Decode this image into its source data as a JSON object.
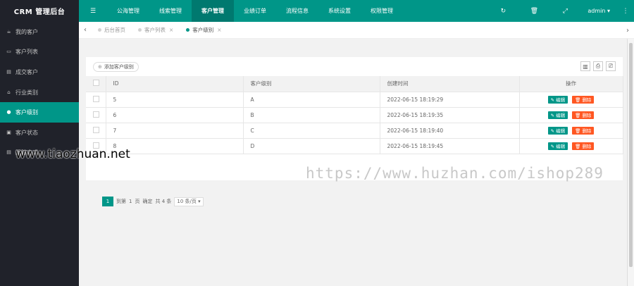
{
  "app": {
    "logo": "CRM  管理后台"
  },
  "sidebar": {
    "items": [
      {
        "icon": "☕",
        "label": "我的客户",
        "active": false
      },
      {
        "icon": "▭",
        "label": "客户列表",
        "active": false
      },
      {
        "icon": "▤",
        "label": "成交客户",
        "active": false
      },
      {
        "icon": "⌂",
        "label": "行业类别",
        "active": false
      },
      {
        "icon": "●",
        "label": "客户级别",
        "active": true
      },
      {
        "icon": "▣",
        "label": "客户状态",
        "active": false
      },
      {
        "icon": "▤",
        "label": "跟踪方式",
        "active": false
      }
    ]
  },
  "topnav": {
    "menu_icon": "☰",
    "items": [
      {
        "label": "公海管理",
        "active": false
      },
      {
        "label": "线索管理",
        "active": false
      },
      {
        "label": "客户管理",
        "active": true
      },
      {
        "label": "业绩订单",
        "active": false
      },
      {
        "label": "流程信息",
        "active": false
      },
      {
        "label": "系统设置",
        "active": false
      },
      {
        "label": "权限管理",
        "active": false
      }
    ],
    "refresh_icon": "↻",
    "clear_icon": "🗑",
    "fullscreen_icon": "⤢",
    "user": "admin ▾",
    "more_icon": "⋮"
  },
  "tabs": {
    "left_arrow": "‹",
    "right_arrow": "›",
    "items": [
      {
        "label": "后台首页",
        "closable": false,
        "active": false
      },
      {
        "label": "客户列表",
        "closable": true,
        "active": false
      },
      {
        "label": "客户级别",
        "closable": true,
        "active": true
      }
    ],
    "close_glyph": "×"
  },
  "toolbar": {
    "add_label": "添加客户级别",
    "add_icon": "⊕",
    "filter_icon": "▥",
    "export_icon": "⎙",
    "print_icon": "⎚"
  },
  "table": {
    "headers": [
      "ID",
      "客户级别",
      "创建时间",
      "操作"
    ],
    "rows": [
      {
        "id": "5",
        "level": "A",
        "created": "2022-06-15 18:19:29"
      },
      {
        "id": "6",
        "level": "B",
        "created": "2022-06-15 18:19:35"
      },
      {
        "id": "7",
        "level": "C",
        "created": "2022-06-15 18:19:40"
      },
      {
        "id": "8",
        "level": "D",
        "created": "2022-06-15 18:19:45"
      }
    ],
    "edit_label": "✎ 编辑",
    "delete_label": "🗑 删除"
  },
  "pager": {
    "current": "1",
    "goto_label": "到第",
    "page": "1",
    "page_unit": "页",
    "confirm": "确定",
    "total": "共 4 条",
    "per_page": "10 条/页 ▾"
  },
  "watermarks": {
    "left": "www.tiaozhuan.net",
    "right": "https://www.huzhan.com/ishop289"
  },
  "colors": {
    "accent": "#009688",
    "danger": "#FF5722",
    "sidebar": "#20222A"
  }
}
